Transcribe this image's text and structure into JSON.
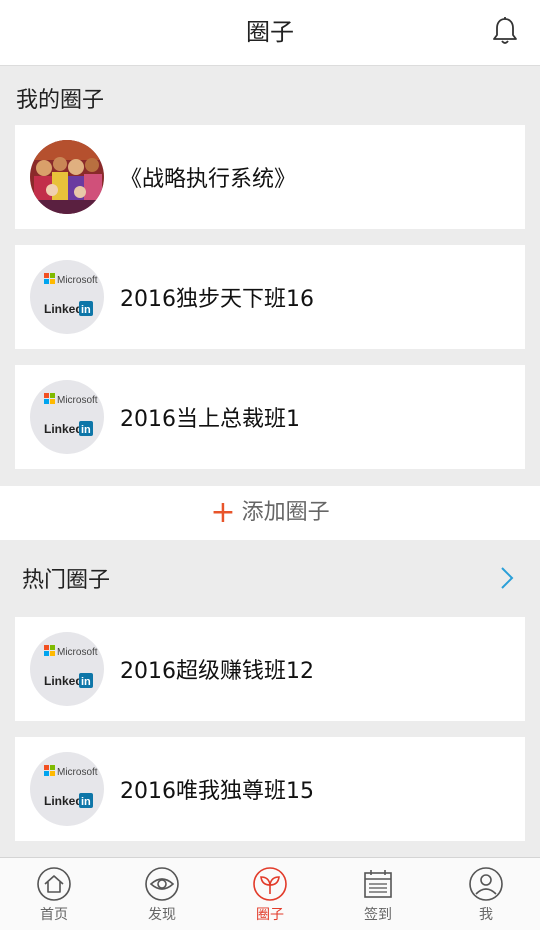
{
  "header": {
    "title": "圈子"
  },
  "my_section": {
    "title": "我的圈子"
  },
  "my_circles": [
    {
      "name": "《战略执行系统》",
      "avatar": "photo"
    },
    {
      "name": "2016独步天下班16",
      "avatar": "microsoft-linkedin-logo"
    },
    {
      "name": "2016当上总裁班1",
      "avatar": "microsoft-linkedin-logo"
    }
  ],
  "add": {
    "label": "添加圈子"
  },
  "hot_section": {
    "title": "热门圈子"
  },
  "hot_circles": [
    {
      "name": "2016超级赚钱班12",
      "avatar": "microsoft-linkedin-logo"
    },
    {
      "name": "2016唯我独尊班15",
      "avatar": "microsoft-linkedin-logo"
    }
  ],
  "logo_text": {
    "microsoft": "Microsoft",
    "linked": "Linked",
    "in": "in"
  },
  "tabs": [
    {
      "label": "首页",
      "icon": "home-icon"
    },
    {
      "label": "发现",
      "icon": "eye-icon"
    },
    {
      "label": "圈子",
      "icon": "sprout-icon",
      "active": true
    },
    {
      "label": "签到",
      "icon": "calendar-icon"
    },
    {
      "label": "我",
      "icon": "user-icon"
    }
  ],
  "colors": {
    "accent": "#e23b2a",
    "plus": "#e8542a",
    "chevron": "#2a9fd8",
    "linkedin": "#0e76a8"
  }
}
